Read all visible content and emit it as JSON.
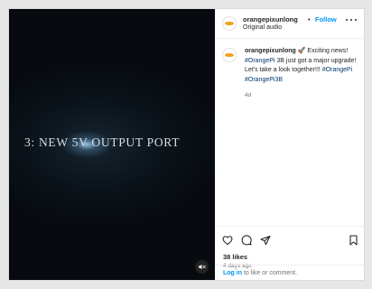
{
  "post": {
    "media": {
      "overlay_text": "3: NEW 5V OUTPUT PORT",
      "mute_icon": "speaker-muted-icon"
    },
    "header": {
      "username": "orangepixunlong",
      "separator": "•",
      "follow_label": "Follow",
      "audio_label": "Original audio",
      "more_icon": "more-options-icon"
    },
    "caption": {
      "username": "orangepixunlong",
      "emoji": "🚀",
      "text_part1": " Exciting news! ",
      "hashtag1": "#OrangePi",
      "text_part2": " 3B just got a major upgrade! Let's take a look together!!! ",
      "hashtag2": "#OrangePi",
      "space": " ",
      "hashtag3": "#OrangePi3B",
      "time": "4d"
    },
    "actions": {
      "like_icon": "heart-icon",
      "comment_icon": "comment-icon",
      "share_icon": "share-icon",
      "save_icon": "bookmark-icon",
      "likes": "38 likes",
      "posted_ago": "4 days ago"
    },
    "login_prompt": {
      "link_label": "Log in",
      "rest_text": " to like or comment."
    }
  },
  "colors": {
    "accent_blue": "#0095f6",
    "hashtag_blue": "#00376b",
    "secondary_text": "#737373",
    "avatar_brand": "#f0a21a"
  }
}
